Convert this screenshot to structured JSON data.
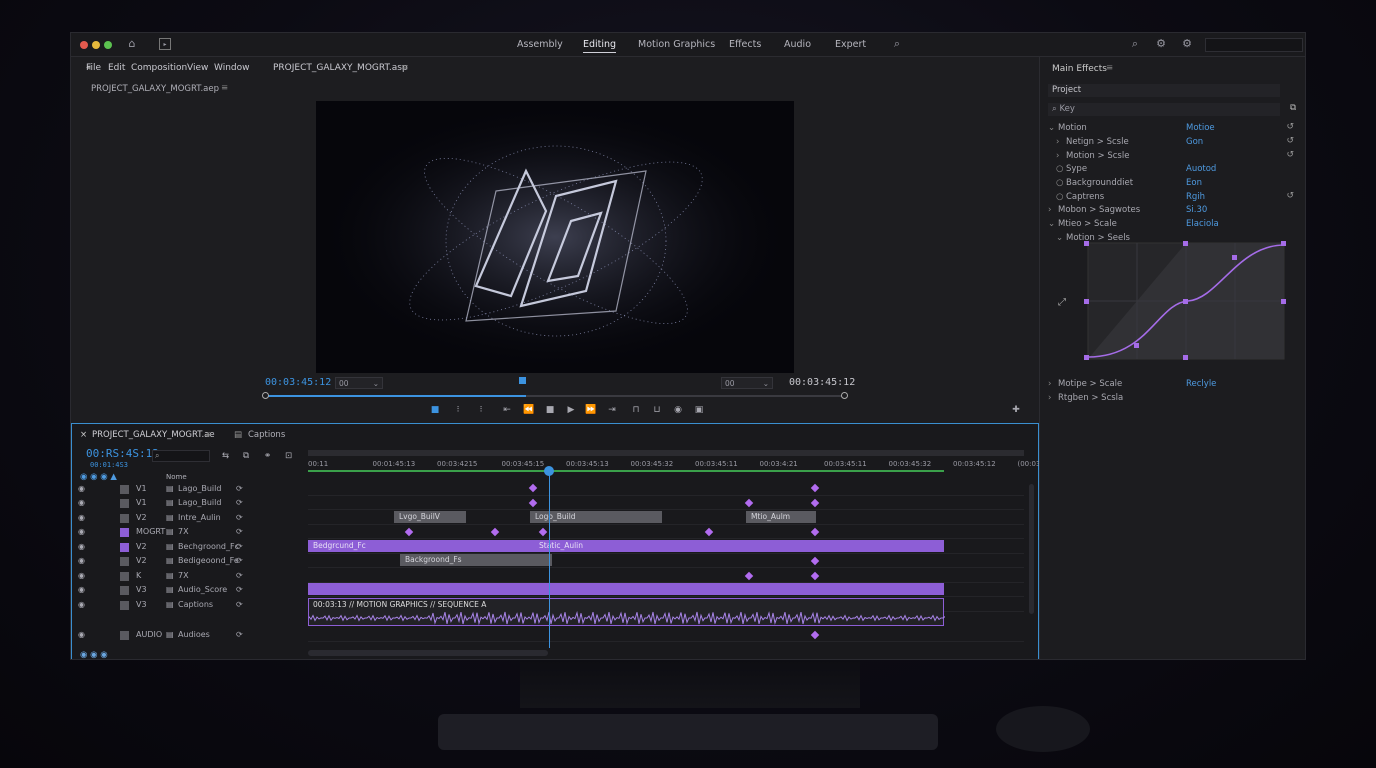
{
  "app": {
    "workspaces": [
      "Assembly",
      "Editing",
      "Motion Graphics",
      "Effects",
      "Audio",
      "Expert"
    ],
    "active_workspace": "Editing",
    "menu": [
      "File",
      "Edit",
      "Composition",
      "View",
      "Window"
    ],
    "project_tab": "PROJECT_GALAXY_MOGRT.asp",
    "project_sub_tab": "PROJECT_GALAXY_MOGRT.aep",
    "colors": {
      "accent": "#8d5ed6",
      "timecode": "#3c93e0",
      "selection_border": "#3a8fd0"
    }
  },
  "program": {
    "timecode_left": "00:03:45:12",
    "timecode_right": "00:03:45:12",
    "zoom_left": "00",
    "zoom_right": "00",
    "scrub_progress": 0.45
  },
  "timeline": {
    "tab": "PROJECT_GALAXY_MOGRT.ae",
    "captions_tab": "Captions",
    "timecode": "00:RS:4S:12",
    "sub_timecode": "00:01:4S3",
    "name_header": "Nome",
    "ruler": [
      "00:11",
      "00:01:45:13",
      "00:03:4215",
      "00:03:45:15",
      "00:03:45:13",
      "00:03:45:32",
      "00:03:45:11",
      "00:03:4:21",
      "00:03:45:11",
      "00:03:45:32",
      "00:03:45:12",
      "(00:03:45:23"
    ],
    "tracks": [
      {
        "id": "V1",
        "name": "Lago_Build"
      },
      {
        "id": "V1",
        "name": "Lago_Build"
      },
      {
        "id": "V2",
        "name": "Intre_Aulin"
      },
      {
        "id": "MOGRT",
        "name": "7X"
      },
      {
        "id": "V2",
        "name": "Bechgroond_Fc"
      },
      {
        "id": "V2",
        "name": "Bedigeoond_Fe"
      },
      {
        "id": "K",
        "name": "7X"
      },
      {
        "id": "V3",
        "name": "Audio_Score"
      },
      {
        "id": "V3",
        "name": "Captions"
      },
      {
        "id": "AUDIO",
        "name": "Audioes"
      }
    ],
    "clips": {
      "logo_build": "Lvgo_BuilV",
      "logo_build2": "Logo_Build",
      "motio": "Mtio_Aulm",
      "bg": "Bedgrcund_Fc",
      "static": "Static_Aulin",
      "bg2": "Backgroond_Fs",
      "captions_text": "00:03:13 // MOTION GRAPHICS // SEQUENCE A"
    }
  },
  "effects": {
    "title": "Main Effects",
    "project_field": "Project",
    "search_placeholder": "Key",
    "rows": [
      {
        "label": "Motion",
        "value": "Motioe"
      },
      {
        "label": "Netign > Scsle",
        "value": "Gon"
      },
      {
        "label": "Motion > Scsle",
        "value": ""
      },
      {
        "label": "Sype",
        "value": "Auotod"
      },
      {
        "label": "Backgrounddiet",
        "value": "Eon"
      },
      {
        "label": "Captrens",
        "value": "Rgih"
      },
      {
        "label": "Mobon > Sagwotes",
        "value": "Si.30"
      },
      {
        "label": "Mtieo > Scale",
        "value": "Elaciola"
      },
      {
        "label": "Motion > Seels",
        "value": ""
      }
    ],
    "bottom_rows": [
      {
        "label": "Motipe > Scale",
        "value": "Reclyle"
      },
      {
        "label": "Rtgben > Scsla",
        "value": ""
      }
    ]
  }
}
